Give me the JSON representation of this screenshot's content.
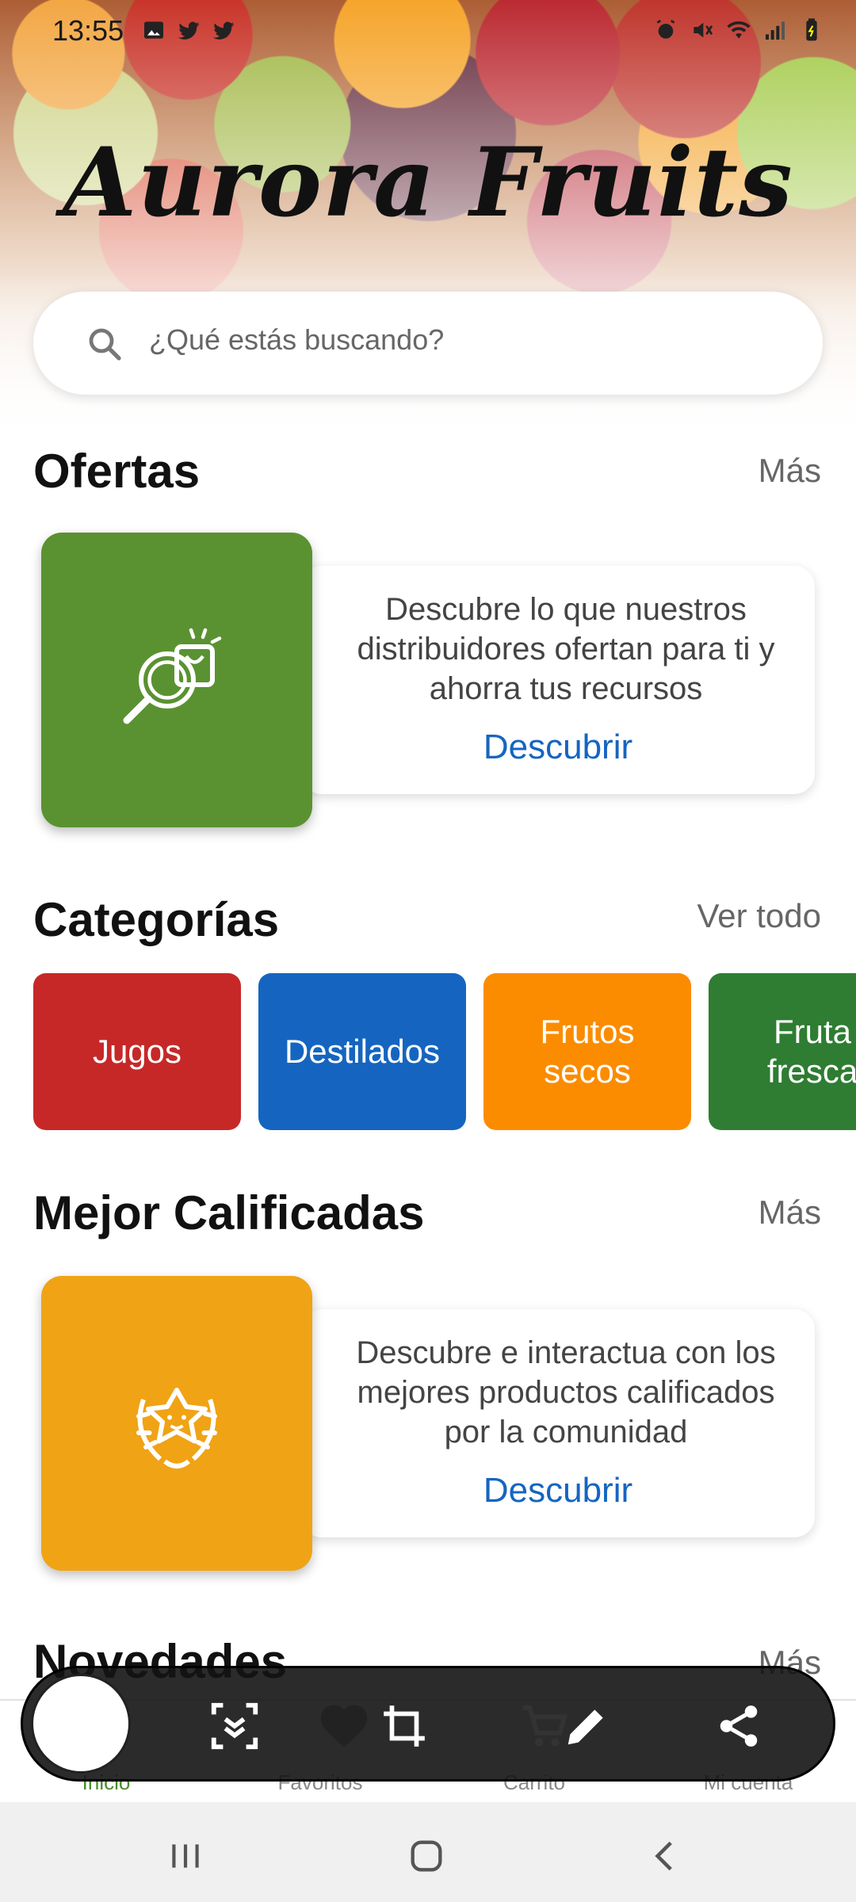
{
  "status_bar": {
    "time": "13:55"
  },
  "brand": {
    "title": "Aurora Fruits"
  },
  "search": {
    "placeholder": "¿Qué estás buscando?"
  },
  "sections": {
    "ofertas": {
      "title": "Ofertas",
      "more": "Más",
      "text": "Descubre lo que nuestros distribuidores ofertan para ti y ahorra tus recursos",
      "link": "Descubrir",
      "tile_color": "#5a9232"
    },
    "categorias": {
      "title": "Categorías",
      "more": "Ver todo",
      "items": [
        {
          "label": "Jugos",
          "color": "#c62828"
        },
        {
          "label": "Destilados",
          "color": "#1565c0"
        },
        {
          "label": "Frutos secos",
          "color": "#fb8c00"
        },
        {
          "label": "Fruta fresca",
          "color": "#2e7d32"
        }
      ]
    },
    "mejor": {
      "title": "Mejor Calificadas",
      "more": "Más",
      "text": "Descubre e interactua con los mejores productos calificados por la comunidad",
      "link": "Descubrir",
      "tile_color": "#f0a314"
    },
    "novedades": {
      "title": "Novedades",
      "more": "Más"
    }
  },
  "bottom_nav": {
    "items": [
      {
        "label": "Inicio"
      },
      {
        "label": "Favoritos"
      },
      {
        "label": "Carrito"
      },
      {
        "label": "Mi cuenta"
      }
    ]
  }
}
